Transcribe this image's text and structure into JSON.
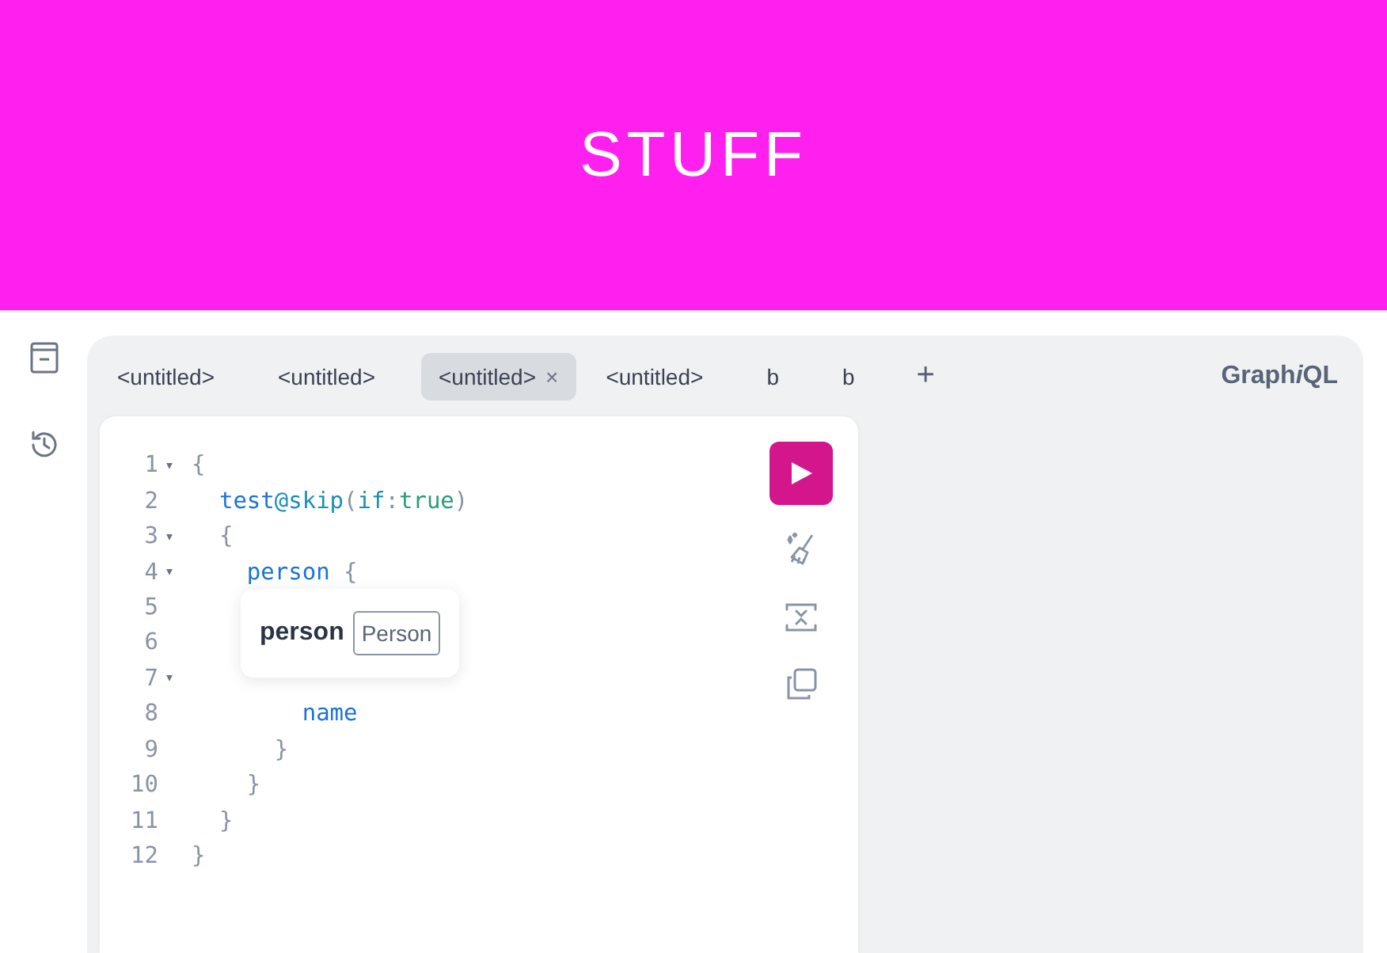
{
  "banner": {
    "title": "STUFF"
  },
  "tabs": [
    {
      "label": "<untitled>",
      "selected": false
    },
    {
      "label": "<untitled>",
      "selected": false
    },
    {
      "label": "<untitled>",
      "selected": true,
      "close": "×"
    },
    {
      "label": "<untitled>",
      "selected": false
    },
    {
      "label": "b",
      "selected": false
    },
    {
      "label": "b",
      "selected": false
    }
  ],
  "add_tab": "+",
  "logo": {
    "start": "Graph",
    "italic": "i",
    "end": "QL"
  },
  "editor": {
    "lines": [
      {
        "number": "1",
        "fold": "▾",
        "tokens": [
          {
            "kind": "punct",
            "text": "{"
          }
        ]
      },
      {
        "number": "2",
        "tokens": [
          {
            "kind": "field",
            "text": "  test"
          },
          {
            "kind": "directive",
            "text": "@skip"
          },
          {
            "kind": "punct",
            "text": "("
          },
          {
            "kind": "arg",
            "text": "if"
          },
          {
            "kind": "punct",
            "text": ":"
          },
          {
            "kind": "value",
            "text": "true"
          },
          {
            "kind": "punct",
            "text": ")"
          }
        ]
      },
      {
        "number": "3",
        "fold": "▾",
        "tokens": [
          {
            "kind": "punct",
            "text": "  {"
          }
        ]
      },
      {
        "number": "4",
        "fold": "▾",
        "tokens": [
          {
            "kind": "field",
            "text": "    person"
          },
          {
            "kind": "punct",
            "text": " {"
          }
        ]
      },
      {
        "number": "5"
      },
      {
        "number": "6"
      },
      {
        "number": "7",
        "fold": "▾"
      },
      {
        "number": "8",
        "tokens": [
          {
            "kind": "field",
            "text": "        name"
          }
        ]
      },
      {
        "number": "9",
        "tokens": [
          {
            "kind": "punct",
            "text": "      }"
          }
        ]
      },
      {
        "number": "10",
        "tokens": [
          {
            "kind": "punct",
            "text": "    }"
          }
        ]
      },
      {
        "number": "11",
        "tokens": [
          {
            "kind": "punct",
            "text": "  }"
          }
        ]
      },
      {
        "number": "12",
        "tokens": [
          {
            "kind": "punct",
            "text": "}"
          }
        ]
      }
    ],
    "tooltip": {
      "name": "person",
      "type": "Person"
    }
  }
}
